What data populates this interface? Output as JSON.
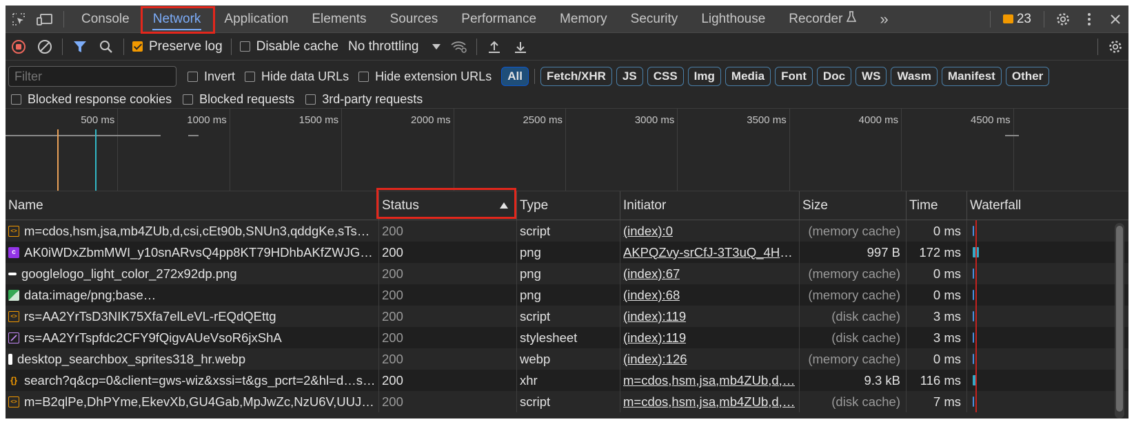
{
  "tabs": [
    {
      "label": "Console"
    },
    {
      "label": "Network"
    },
    {
      "label": "Application"
    },
    {
      "label": "Elements"
    },
    {
      "label": "Sources"
    },
    {
      "label": "Performance"
    },
    {
      "label": "Memory"
    },
    {
      "label": "Security"
    },
    {
      "label": "Lighthouse"
    },
    {
      "label": "Recorder"
    }
  ],
  "active_tab": "Network",
  "more_tabs": "»",
  "issues_count": "23",
  "toolbar": {
    "preserve_log": "Preserve log",
    "preserve_log_checked": true,
    "disable_cache": "Disable cache",
    "disable_cache_checked": false,
    "throttling": "No throttling"
  },
  "filter": {
    "placeholder": "Filter",
    "invert": "Invert",
    "hide_data_urls": "Hide data URLs",
    "hide_extension_urls": "Hide extension URLs",
    "types": [
      "All",
      "Fetch/XHR",
      "JS",
      "CSS",
      "Img",
      "Media",
      "Font",
      "Doc",
      "WS",
      "Wasm",
      "Manifest",
      "Other"
    ],
    "active_type": "All",
    "blocked_response_cookies": "Blocked response cookies",
    "blocked_requests": "Blocked requests",
    "third_party_requests": "3rd-party requests"
  },
  "overview": {
    "ticks": [
      "500 ms",
      "1000 ms",
      "1500 ms",
      "2000 ms",
      "2500 ms",
      "3000 ms",
      "3500 ms",
      "4000 ms",
      "4500 ms"
    ],
    "dom_content_loaded_ms": 230,
    "load_ms": 400
  },
  "columns": {
    "name": "Name",
    "status": "Status",
    "type": "Type",
    "initiator": "Initiator",
    "size": "Size",
    "time": "Time",
    "waterfall": "Waterfall"
  },
  "sorted_column": "Status",
  "rows": [
    {
      "name": "m=cdos,hsm,jsa,mb4ZUb,d,csi,cEt90b,SNUn3,qddgKe,sTsD…",
      "status": "200",
      "type": "script",
      "initiator": "(index):0",
      "size": "(memory cache)",
      "time": "0 ms",
      "icon": "script-icon",
      "icon_color": "#f29900"
    },
    {
      "name": "AK0iWDxZbmMWI_y10snARvsQ4pp8KT79HDhbAKfZWJGyH…",
      "status": "200",
      "type": "png",
      "initiator": "AKPQZvy-srCfJ-3T3uQ_4HL…",
      "size": "997 B",
      "time": "172 ms",
      "icon": "image-icon",
      "icon_color": "#9334e6"
    },
    {
      "name": "googlelogo_light_color_272x92dp.png",
      "status": "200",
      "type": "png",
      "initiator": "(index):67",
      "size": "(memory cache)",
      "time": "0 ms",
      "icon": "image-icon",
      "icon_color": "#ffffff"
    },
    {
      "name": "data:image/png;base…",
      "status": "200",
      "type": "png",
      "initiator": "(index):68",
      "size": "(memory cache)",
      "time": "0 ms",
      "icon": "image-icon",
      "icon_color": "#34a853"
    },
    {
      "name": "rs=AA2YrTsD3NIK75Xfa7elLeVL-rEQdQEttg",
      "status": "200",
      "type": "script",
      "initiator": "(index):119",
      "size": "(disk cache)",
      "time": "3 ms",
      "icon": "script-icon",
      "icon_color": "#f29900"
    },
    {
      "name": "rs=AA2YrTspfdc2CFY9fQigvAUeVsoR6jxShA",
      "status": "200",
      "type": "stylesheet",
      "initiator": "(index):119",
      "size": "(disk cache)",
      "time": "3 ms",
      "icon": "stylesheet-icon",
      "icon_color": "#c58af9"
    },
    {
      "name": "desktop_searchbox_sprites318_hr.webp",
      "status": "200",
      "type": "webp",
      "initiator": "(index):126",
      "size": "(memory cache)",
      "time": "0 ms",
      "icon": "image-icon",
      "icon_color": "#ffffff"
    },
    {
      "name": "search?q&cp=0&client=gws-wiz&xssi=t&gs_pcrt=2&hl=d…sA…",
      "status": "200",
      "type": "xhr",
      "initiator": "m=cdos,hsm,jsa,mb4ZUb,d,…",
      "size": "9.3 kB",
      "time": "116 ms",
      "icon": "xhr-icon",
      "icon_color": "#f29900"
    },
    {
      "name": "m=B2qlPe,DhPYme,EkevXb,GU4Gab,MpJwZc,NzU6V,UUJq…",
      "status": "200",
      "type": "script",
      "initiator": "m=cdos,hsm,jsa,mb4ZUb,d,…",
      "size": "(disk cache)",
      "time": "7 ms",
      "icon": "script-icon",
      "icon_color": "#f29900"
    }
  ]
}
